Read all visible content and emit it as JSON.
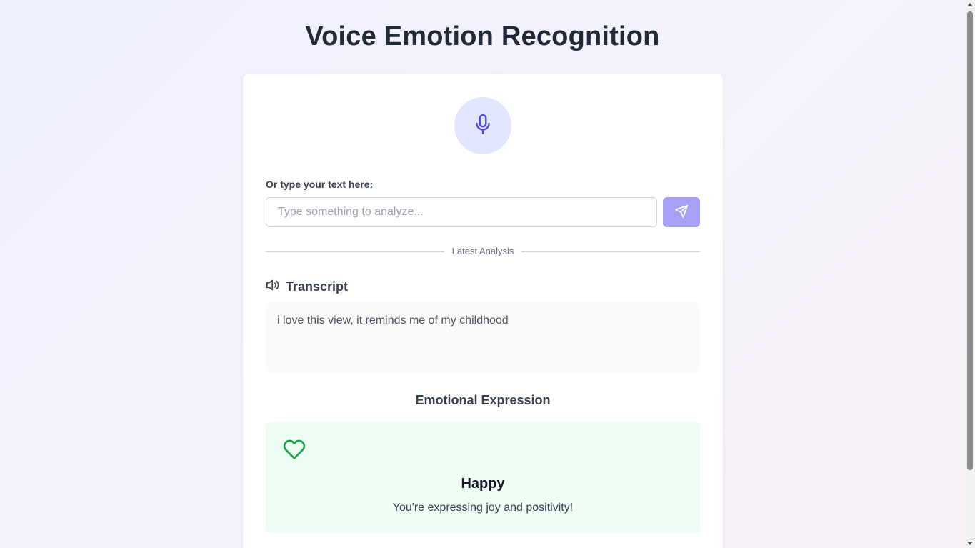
{
  "app": {
    "title": "Voice Emotion Recognition"
  },
  "input": {
    "label": "Or type your text here:",
    "placeholder": "Type something to analyze...",
    "value": ""
  },
  "icons": {
    "mic": "microphone-icon",
    "send": "send-icon",
    "speaker": "speaker-icon",
    "emotion": "heart-icon"
  },
  "divider": {
    "label": "Latest Analysis"
  },
  "transcript": {
    "heading": "Transcript",
    "text": "i love this view, it reminds me of my childhood"
  },
  "emotion": {
    "heading": "Emotional Expression",
    "name": "Happy",
    "description": "You're expressing joy and positivity!",
    "color": "#16a34a",
    "background": "#f0fdf4"
  },
  "colors": {
    "accent": "#4f46e5",
    "mic_bg": "#e0e7ff",
    "send_bg": "#a5a1f5"
  }
}
